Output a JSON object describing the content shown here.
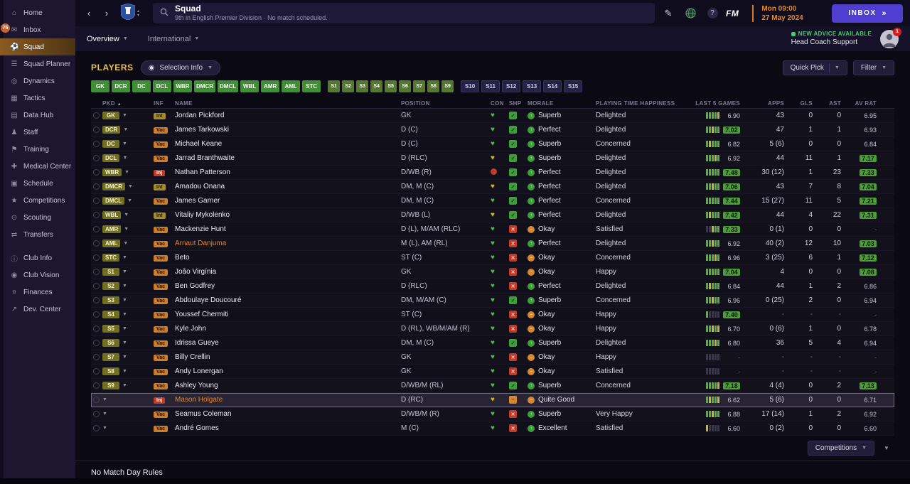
{
  "sidebar": {
    "items": [
      {
        "id": "home",
        "label": "Home",
        "icon": "home"
      },
      {
        "id": "inbox",
        "label": "Inbox",
        "icon": "inbox",
        "badge": "75"
      },
      {
        "id": "squad",
        "label": "Squad",
        "icon": "squad",
        "active": true
      },
      {
        "id": "squad-planner",
        "label": "Squad Planner",
        "icon": "planner"
      },
      {
        "id": "dynamics",
        "label": "Dynamics",
        "icon": "dynamics"
      },
      {
        "id": "tactics",
        "label": "Tactics",
        "icon": "tactics"
      },
      {
        "id": "data-hub",
        "label": "Data Hub",
        "icon": "datahub"
      },
      {
        "id": "staff",
        "label": "Staff",
        "icon": "staff"
      },
      {
        "id": "training",
        "label": "Training",
        "icon": "training"
      },
      {
        "id": "medical-center",
        "label": "Medical Center",
        "icon": "medical"
      },
      {
        "id": "schedule",
        "label": "Schedule",
        "icon": "schedule"
      },
      {
        "id": "competitions",
        "label": "Competitions",
        "icon": "competitions"
      },
      {
        "id": "scouting",
        "label": "Scouting",
        "icon": "scouting"
      },
      {
        "id": "transfers",
        "label": "Transfers",
        "icon": "transfers"
      },
      {
        "id": "club-info",
        "label": "Club Info",
        "icon": "clubinfo",
        "gap": true
      },
      {
        "id": "club-vision",
        "label": "Club Vision",
        "icon": "clubvision"
      },
      {
        "id": "finances",
        "label": "Finances",
        "icon": "finances"
      },
      {
        "id": "dev-center",
        "label": "Dev. Center",
        "icon": "devcenter"
      }
    ]
  },
  "topbar": {
    "title": "Squad",
    "subtitle": "9th in English Premier Division · No match scheduled.",
    "date_line1": "Mon 09:00",
    "date_line2": "27 May 2024",
    "inbox_label": "INBOX",
    "inbox_arrows": "»",
    "fm_logo": "FM",
    "help_glyph": "?"
  },
  "subbar": {
    "tabs": [
      {
        "label": "Overview",
        "active": true
      },
      {
        "label": "International",
        "active": false
      }
    ],
    "advice_title": "NEW ADVICE AVAILABLE",
    "advice_subtitle": "Head Coach Support",
    "avatar_badge": "1"
  },
  "players_panel": {
    "title": "PLAYERS",
    "selection_info_label": "Selection Info",
    "quick_pick_label": "Quick Pick",
    "filter_label": "Filter",
    "position_buttons": [
      {
        "label": "GK",
        "type": "starter"
      },
      {
        "label": "DCR",
        "type": "starter"
      },
      {
        "label": "DC",
        "type": "starter"
      },
      {
        "label": "DCL",
        "type": "starter"
      },
      {
        "label": "WBR",
        "type": "starter"
      },
      {
        "label": "DMCR",
        "type": "starter"
      },
      {
        "label": "DMCL",
        "type": "starter"
      },
      {
        "label": "WBL",
        "type": "starter"
      },
      {
        "label": "AMR",
        "type": "starter"
      },
      {
        "label": "AML",
        "type": "starter"
      },
      {
        "label": "STC",
        "type": "starter"
      },
      {
        "label": "S1",
        "type": "sub"
      },
      {
        "label": "S2",
        "type": "sub"
      },
      {
        "label": "S3",
        "type": "sub"
      },
      {
        "label": "S4",
        "type": "sub"
      },
      {
        "label": "S5",
        "type": "sub"
      },
      {
        "label": "S6",
        "type": "sub"
      },
      {
        "label": "S7",
        "type": "sub"
      },
      {
        "label": "S8",
        "type": "sub"
      },
      {
        "label": "S9",
        "type": "sub"
      },
      {
        "label": "S10",
        "type": "reserve"
      },
      {
        "label": "S11",
        "type": "reserve"
      },
      {
        "label": "S12",
        "type": "reserve"
      },
      {
        "label": "S13",
        "type": "reserve"
      },
      {
        "label": "S14",
        "type": "reserve"
      },
      {
        "label": "S15",
        "type": "reserve"
      }
    ],
    "columns": [
      "PKD",
      "INF",
      "NAME",
      "POSITION",
      "CON",
      "SHP",
      "MORALE",
      "PLAYING TIME HAPPINESS",
      "LAST 5 GAMES",
      "APPS",
      "GLS",
      "AST",
      "AV RAT"
    ],
    "sort_icon": "▲",
    "players": [
      {
        "pkd": "GK",
        "inf": "Int",
        "inf_type": "int",
        "name": "Jordan Pickford",
        "name_orange": false,
        "pos": "GK",
        "con": "g",
        "shp": "check",
        "morale": "Superb",
        "morale_tone": "good",
        "happy": "Delighted",
        "bars": [
          "g",
          "g",
          "g",
          "g",
          "y"
        ],
        "last5": "6.90",
        "last5_hl": false,
        "apps": "43",
        "gls": "0",
        "ast": "0",
        "avrat": "6.95",
        "avrat_hl": false,
        "selected": false
      },
      {
        "pkd": "DCR",
        "inf": "Vac",
        "inf_type": "vac",
        "name": "James Tarkowski",
        "name_orange": false,
        "pos": "D (C)",
        "con": "g",
        "shp": "check",
        "morale": "Perfect",
        "morale_tone": "good",
        "happy": "Delighted",
        "bars": [
          "g",
          "g",
          "y",
          "g",
          "g"
        ],
        "last5": "7.02",
        "last5_hl": true,
        "apps": "47",
        "gls": "1",
        "ast": "1",
        "avrat": "6.93",
        "avrat_hl": false,
        "selected": false
      },
      {
        "pkd": "DC",
        "inf": "Vac",
        "inf_type": "vac",
        "name": "Michael Keane",
        "name_orange": false,
        "pos": "D (C)",
        "con": "g",
        "shp": "check",
        "morale": "Superb",
        "morale_tone": "good",
        "happy": "Concerned",
        "bars": [
          "g",
          "y",
          "g",
          "g",
          "g"
        ],
        "last5": "6.82",
        "last5_hl": false,
        "apps": "5 (6)",
        "gls": "0",
        "ast": "0",
        "avrat": "6.84",
        "avrat_hl": false,
        "selected": false
      },
      {
        "pkd": "DCL",
        "inf": "Vac",
        "inf_type": "vac",
        "name": "Jarrad Branthwaite",
        "name_orange": false,
        "pos": "D (RLC)",
        "con": "y",
        "shp": "check",
        "morale": "Superb",
        "morale_tone": "good",
        "happy": "Delighted",
        "bars": [
          "g",
          "g",
          "g",
          "y",
          "g"
        ],
        "last5": "6.92",
        "last5_hl": false,
        "apps": "44",
        "gls": "11",
        "ast": "1",
        "avrat": "7.17",
        "avrat_hl": true,
        "selected": false
      },
      {
        "pkd": "WBR",
        "inf": "Inj",
        "inf_type": "inj",
        "name": "Nathan Patterson",
        "name_orange": false,
        "pos": "D/WB (R)",
        "con": "r",
        "shp": "check",
        "morale": "Perfect",
        "morale_tone": "good",
        "happy": "Delighted",
        "bars": [
          "g",
          "g",
          "g",
          "g",
          "g"
        ],
        "last5": "7.48",
        "last5_hl": true,
        "apps": "30 (12)",
        "gls": "1",
        "ast": "23",
        "avrat": "7.33",
        "avrat_hl": true,
        "selected": false
      },
      {
        "pkd": "DMCR",
        "inf": "Int",
        "inf_type": "int",
        "name": "Amadou Onana",
        "name_orange": false,
        "pos": "DM, M (C)",
        "con": "y",
        "shp": "check",
        "morale": "Perfect",
        "morale_tone": "good",
        "happy": "Delighted",
        "bars": [
          "g",
          "g",
          "y",
          "g",
          "g"
        ],
        "last5": "7.06",
        "last5_hl": true,
        "apps": "43",
        "gls": "7",
        "ast": "8",
        "avrat": "7.04",
        "avrat_hl": true,
        "selected": false
      },
      {
        "pkd": "DMCL",
        "inf": "Vac",
        "inf_type": "vac",
        "name": "James Garner",
        "name_orange": false,
        "pos": "DM, M (C)",
        "con": "g",
        "shp": "check",
        "morale": "Perfect",
        "morale_tone": "good",
        "happy": "Concerned",
        "bars": [
          "g",
          "g",
          "g",
          "g",
          "g"
        ],
        "last5": "7.44",
        "last5_hl": true,
        "apps": "15 (27)",
        "gls": "11",
        "ast": "5",
        "avrat": "7.21",
        "avrat_hl": true,
        "selected": false
      },
      {
        "pkd": "WBL",
        "inf": "Int",
        "inf_type": "int",
        "name": "Vitaliy Mykolenko",
        "name_orange": false,
        "pos": "D/WB (L)",
        "con": "y",
        "shp": "check",
        "morale": "Perfect",
        "morale_tone": "good",
        "happy": "Delighted",
        "bars": [
          "g",
          "y",
          "g",
          "g",
          "g"
        ],
        "last5": "7.42",
        "last5_hl": true,
        "apps": "44",
        "gls": "4",
        "ast": "22",
        "avrat": "7.31",
        "avrat_hl": true,
        "selected": false
      },
      {
        "pkd": "AMR",
        "inf": "Vac",
        "inf_type": "vac",
        "name": "Mackenzie Hunt",
        "name_orange": false,
        "pos": "D (L), M/AM (RLC)",
        "con": "g",
        "shp": "cross",
        "morale": "Okay",
        "morale_tone": "ok",
        "happy": "Satisfied",
        "bars": [
          "x",
          "x",
          "y",
          "g",
          "g"
        ],
        "last5": "7.33",
        "last5_hl": true,
        "apps": "0 (1)",
        "gls": "0",
        "ast": "0",
        "avrat": "-",
        "avrat_hl": false,
        "selected": false
      },
      {
        "pkd": "AML",
        "inf": "Vac",
        "inf_type": "vac",
        "name": "Arnaut Danjuma",
        "name_orange": true,
        "pos": "M (L), AM (RL)",
        "con": "g",
        "shp": "cross",
        "morale": "Perfect",
        "morale_tone": "good",
        "happy": "Delighted",
        "bars": [
          "g",
          "g",
          "y",
          "g",
          "g"
        ],
        "last5": "6.92",
        "last5_hl": false,
        "apps": "40 (2)",
        "gls": "12",
        "ast": "10",
        "avrat": "7.03",
        "avrat_hl": true,
        "selected": false
      },
      {
        "pkd": "STC",
        "inf": "Vac",
        "inf_type": "vac",
        "name": "Beto",
        "name_orange": false,
        "pos": "ST (C)",
        "con": "g",
        "shp": "cross",
        "morale": "Okay",
        "morale_tone": "ok",
        "happy": "Concerned",
        "bars": [
          "g",
          "g",
          "g",
          "y",
          "g"
        ],
        "last5": "6.96",
        "last5_hl": false,
        "apps": "3 (25)",
        "gls": "6",
        "ast": "1",
        "avrat": "7.12",
        "avrat_hl": true,
        "selected": false
      },
      {
        "pkd": "S1",
        "inf": "Vac",
        "inf_type": "vac",
        "name": "João Virgínia",
        "name_orange": false,
        "pos": "GK",
        "con": "g",
        "shp": "cross",
        "morale": "Okay",
        "morale_tone": "ok",
        "happy": "Happy",
        "bars": [
          "g",
          "g",
          "g",
          "g",
          "g"
        ],
        "last5": "7.04",
        "last5_hl": true,
        "apps": "4",
        "gls": "0",
        "ast": "0",
        "avrat": "7.08",
        "avrat_hl": true,
        "selected": false
      },
      {
        "pkd": "S2",
        "inf": "Vac",
        "inf_type": "vac",
        "name": "Ben Godfrey",
        "name_orange": false,
        "pos": "D (RLC)",
        "con": "g",
        "shp": "cross",
        "morale": "Perfect",
        "morale_tone": "good",
        "happy": "Delighted",
        "bars": [
          "g",
          "y",
          "g",
          "g",
          "g"
        ],
        "last5": "6.84",
        "last5_hl": false,
        "apps": "44",
        "gls": "1",
        "ast": "2",
        "avrat": "6.86",
        "avrat_hl": false,
        "selected": false
      },
      {
        "pkd": "S3",
        "inf": "Vac",
        "inf_type": "vac",
        "name": "Abdoulaye Doucouré",
        "name_orange": false,
        "pos": "DM, M/AM (C)",
        "con": "g",
        "shp": "check",
        "morale": "Superb",
        "morale_tone": "good",
        "happy": "Concerned",
        "bars": [
          "g",
          "g",
          "y",
          "g",
          "g"
        ],
        "last5": "6.96",
        "last5_hl": false,
        "apps": "0 (25)",
        "gls": "2",
        "ast": "0",
        "avrat": "6.94",
        "avrat_hl": false,
        "selected": false
      },
      {
        "pkd": "S4",
        "inf": "Vac",
        "inf_type": "vac",
        "name": "Youssef Chermiti",
        "name_orange": false,
        "pos": "ST (C)",
        "con": "g",
        "shp": "cross",
        "morale": "Okay",
        "morale_tone": "ok",
        "happy": "Happy",
        "bars": [
          "g",
          "x",
          "x",
          "x",
          "x"
        ],
        "last5": "7.40",
        "last5_hl": true,
        "apps": "-",
        "gls": "-",
        "ast": "-",
        "avrat": "-",
        "avrat_hl": false,
        "selected": false
      },
      {
        "pkd": "S5",
        "inf": "Vac",
        "inf_type": "vac",
        "name": "Kyle John",
        "name_orange": false,
        "pos": "D (RL), WB/M/AM (R)",
        "con": "g",
        "shp": "cross",
        "morale": "Okay",
        "morale_tone": "ok",
        "happy": "Happy",
        "bars": [
          "g",
          "g",
          "y",
          "g",
          "y"
        ],
        "last5": "6.70",
        "last5_hl": false,
        "apps": "0 (6)",
        "gls": "1",
        "ast": "0",
        "avrat": "6.78",
        "avrat_hl": false,
        "selected": false
      },
      {
        "pkd": "S6",
        "inf": "Vac",
        "inf_type": "vac",
        "name": "Idrissa Gueye",
        "name_orange": false,
        "pos": "DM, M (C)",
        "con": "g",
        "shp": "check",
        "morale": "Superb",
        "morale_tone": "good",
        "happy": "Delighted",
        "bars": [
          "g",
          "g",
          "g",
          "y",
          "g"
        ],
        "last5": "6.80",
        "last5_hl": false,
        "apps": "36",
        "gls": "5",
        "ast": "4",
        "avrat": "6.94",
        "avrat_hl": false,
        "selected": false
      },
      {
        "pkd": "S7",
        "inf": "Vac",
        "inf_type": "vac",
        "name": "Billy Crellin",
        "name_orange": false,
        "pos": "GK",
        "con": "g",
        "shp": "cross",
        "morale": "Okay",
        "morale_tone": "ok",
        "happy": "Happy",
        "bars": [
          "x",
          "x",
          "x",
          "x",
          "x"
        ],
        "last5": "-",
        "last5_hl": false,
        "apps": "-",
        "gls": "-",
        "ast": "-",
        "avrat": "-",
        "avrat_hl": false,
        "selected": false
      },
      {
        "pkd": "S8",
        "inf": "Vac",
        "inf_type": "vac",
        "name": "Andy Lonergan",
        "name_orange": false,
        "pos": "GK",
        "con": "g",
        "shp": "cross",
        "morale": "Okay",
        "morale_tone": "ok",
        "happy": "Satisfied",
        "bars": [
          "x",
          "x",
          "x",
          "x",
          "x"
        ],
        "last5": "-",
        "last5_hl": false,
        "apps": "-",
        "gls": "-",
        "ast": "-",
        "avrat": "-",
        "avrat_hl": false,
        "selected": false
      },
      {
        "pkd": "S9",
        "inf": "Vac",
        "inf_type": "vac",
        "name": "Ashley Young",
        "name_orange": false,
        "pos": "D/WB/M (RL)",
        "con": "g",
        "shp": "check",
        "morale": "Superb",
        "morale_tone": "good",
        "happy": "Concerned",
        "bars": [
          "g",
          "g",
          "g",
          "g",
          "y"
        ],
        "last5": "7.18",
        "last5_hl": true,
        "apps": "4 (4)",
        "gls": "0",
        "ast": "2",
        "avrat": "7.13",
        "avrat_hl": true,
        "selected": false
      },
      {
        "pkd": "",
        "inf": "Inj",
        "inf_type": "inj",
        "name": "Mason Holgate",
        "name_orange": true,
        "pos": "D (RC)",
        "con": "y",
        "shp": "minus",
        "morale": "Quite Good",
        "morale_tone": "ok",
        "happy": "",
        "bars": [
          "g",
          "y",
          "g",
          "g",
          "y"
        ],
        "last5": "6.62",
        "last5_hl": false,
        "apps": "5 (6)",
        "gls": "0",
        "ast": "0",
        "avrat": "6.71",
        "avrat_hl": false,
        "selected": true
      },
      {
        "pkd": "",
        "inf": "Vac",
        "inf_type": "vac",
        "name": "Seamus Coleman",
        "name_orange": false,
        "pos": "D/WB/M (R)",
        "con": "g",
        "shp": "cross",
        "morale": "Superb",
        "morale_tone": "good",
        "happy": "Very Happy",
        "bars": [
          "g",
          "g",
          "y",
          "g",
          "g"
        ],
        "last5": "6.88",
        "last5_hl": false,
        "apps": "17 (14)",
        "gls": "1",
        "ast": "2",
        "avrat": "6.92",
        "avrat_hl": false,
        "selected": false
      },
      {
        "pkd": "",
        "inf": "Vac",
        "inf_type": "vac",
        "name": "André Gomes",
        "name_orange": false,
        "pos": "M (C)",
        "con": "g",
        "shp": "cross",
        "morale": "Excellent",
        "morale_tone": "good",
        "happy": "Satisfied",
        "bars": [
          "y",
          "x",
          "x",
          "x",
          "x"
        ],
        "last5": "6.60",
        "last5_hl": false,
        "apps": "0 (2)",
        "gls": "0",
        "ast": "0",
        "avrat": "6.60",
        "avrat_hl": false,
        "selected": false
      }
    ],
    "footer": {
      "no_match_day_rules": "No Match Day Rules",
      "competitions_label": "Competitions"
    }
  }
}
